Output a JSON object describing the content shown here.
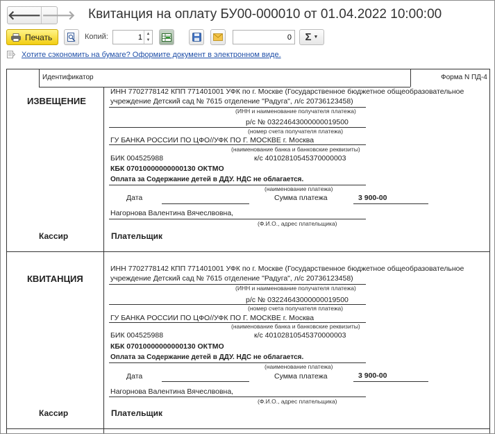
{
  "window": {
    "title": "Квитанция на оплату БУ00-000010 от 01.04.2022 10:00:00",
    "back_glyph": "🡐",
    "forward_glyph": "🡒"
  },
  "toolbar": {
    "print_label": "Печать",
    "copies_label": "Копий:",
    "copies_value": "1",
    "sum_value": "0",
    "sigma_glyph": "Σ",
    "accent_color": "#f2cd12"
  },
  "hint": {
    "link_text": "Хотите сэкономить на бумаге? Оформите документ в электронном виде."
  },
  "document": {
    "header": {
      "identifier_label": "Идентификатор",
      "form_label": "Форма N ПД-4"
    },
    "sections": [
      {
        "title": "ИЗВЕЩЕНИЕ",
        "recipient_line1": "ИНН 7702778142 КПП 771401001 УФК по г. Москве (Государственное бюджетное общеобразовательное",
        "recipient_line2": "учреждение Детский сад № 7615 отделение \"Радуга\", л/с 20736123458)",
        "recipient_caption": "(ИНН и наименование получателя платежа)",
        "account": "р/с №  03224643000000019500",
        "account_caption": "(номер счета получателя платежа)",
        "bank": "ГУ БАНКА РОССИИ ПО ЦФО//УФК ПО Г. МОСКВЕ г. Москва",
        "bank_caption": "(наименование банка и банковские реквизиты)",
        "bik": "БИК  004525988",
        "ks": "к/с  40102810545370000003",
        "kbk": "КБК 07010000000000130 ОКТМО",
        "purpose": "Оплата за Содержание детей в ДДУ. НДС не облагается.",
        "purpose_caption": "(наименование платежа)",
        "date_label": "Дата",
        "sum_label": "Сумма платежа",
        "sum_value": "3 900-00",
        "payer_name": "Нагорнова Валентина Вячеслвовна,",
        "payer_caption": "(Ф.И.О., адрес плательщика)",
        "cashier_label": "Кассир",
        "payer_label": "Плательщик"
      },
      {
        "title": "КВИТАНЦИЯ",
        "recipient_line1": "ИНН 7702778142 КПП 771401001 УФК по г. Москве (Государственное бюджетное общеобразовательное",
        "recipient_line2": "учреждение Детский сад № 7615 отделение \"Радуга\", л/с 20736123458)",
        "recipient_caption": "(ИНН и наименование получателя платежа)",
        "account": "р/с №  03224643000000019500",
        "account_caption": "(номер счета получателя платежа)",
        "bank": "ГУ БАНКА РОССИИ ПО ЦФО//УФК ПО Г. МОСКВЕ г. Москва",
        "bank_caption": "(наименование банка и банковские реквизиты)",
        "bik": "БИК  004525988",
        "ks": "к/с  40102810545370000003",
        "kbk": "КБК 07010000000000130 ОКТМО",
        "purpose": "Оплата за Содержание детей в ДДУ. НДС не облагается.",
        "purpose_caption": "(наименование платежа)",
        "date_label": "Дата",
        "sum_label": "Сумма платежа",
        "sum_value": "3 900-00",
        "payer_name": "Нагорнова Валентина Вячеслвовна,",
        "payer_caption": "(Ф.И.О., адрес плательщика)",
        "cashier_label": "Кассир",
        "payer_label": "Плательщик"
      }
    ]
  }
}
